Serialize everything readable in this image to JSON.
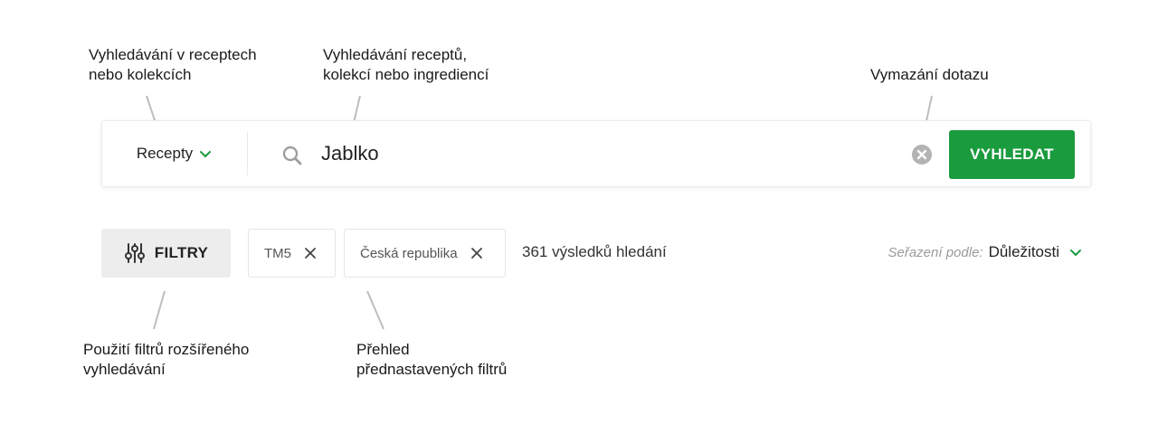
{
  "annotations": {
    "scope_note": [
      "Vyhledávání v receptech",
      "nebo kolekcích"
    ],
    "query_note": [
      "Vyhledávání receptů,",
      "kolekcí nebo ingrediencí"
    ],
    "clear_note": [
      "Vymazání dotazu"
    ],
    "filters_note": [
      "Použití filtrů rozšířeného",
      "vyhledávání"
    ],
    "chips_note": [
      "Přehled",
      "přednastavených filtrů"
    ]
  },
  "search": {
    "scope_label": "Recepty",
    "query_value": "Jablko",
    "button_label": "VYHLEDAT"
  },
  "filters": {
    "button_label": "FILTRY",
    "chips": [
      {
        "label": "TM5"
      },
      {
        "label": "Česká republika"
      }
    ],
    "results_count_text": "361 výsledků hledání"
  },
  "sort": {
    "label": "Seřazení podle:",
    "value": "Důležitosti"
  },
  "colors": {
    "accent": "#1a9b3e",
    "filter_button_bg": "#ededed",
    "leader_line": "#bdbdbd"
  }
}
